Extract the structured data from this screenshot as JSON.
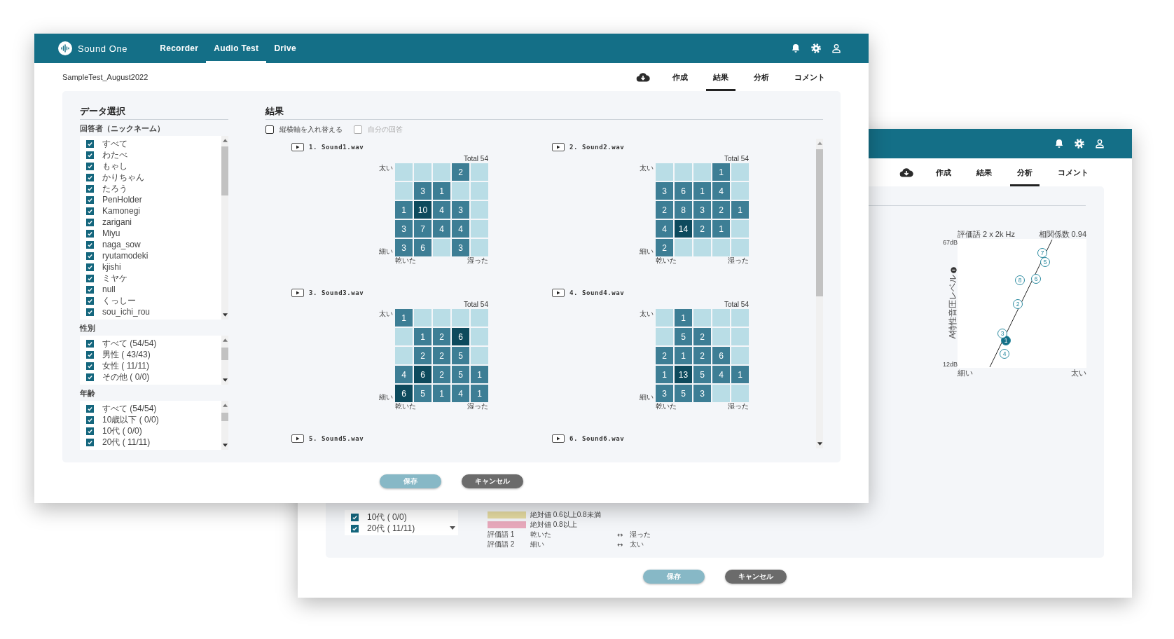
{
  "back_window": {
    "tabs": [
      {
        "label": "作成",
        "selected": false
      },
      {
        "label": "結果",
        "selected": false
      },
      {
        "label": "分析",
        "selected": true
      },
      {
        "label": "コメント",
        "selected": false
      }
    ],
    "chart": {
      "title": "評価語 2 x 2k Hz",
      "correlation": "相関係数 0.94",
      "y_top": "67dB",
      "y_bottom": "12dB",
      "y_label": "A特性音圧レベル",
      "x_left": "細い",
      "x_right": "太い",
      "points": [
        {
          "label": "1",
          "selected": true
        },
        {
          "label": "2",
          "selected": false
        },
        {
          "label": "3",
          "selected": false
        },
        {
          "label": "4",
          "selected": false
        },
        {
          "label": "5",
          "selected": false
        },
        {
          "label": "6",
          "selected": false
        },
        {
          "label": "7",
          "selected": false
        },
        {
          "label": "8",
          "selected": false
        }
      ]
    },
    "age_items": [
      {
        "label": "10代 ( 0/0)",
        "checked": true
      },
      {
        "label": "20代 ( 11/11)",
        "checked": true
      }
    ],
    "legend": [
      {
        "label": "絶対値 0.6以上0.8未満",
        "color": "#e6dca2"
      },
      {
        "label": "絶対値 0.8以上",
        "color": "#e8a9bc"
      }
    ],
    "terms": [
      {
        "name": "評価語 1",
        "left": "乾いた",
        "arrow": "↔",
        "right": "湿った"
      },
      {
        "name": "評価語 2",
        "left": "細い",
        "arrow": "↔",
        "right": "太い"
      }
    ],
    "buttons": [
      {
        "label": "保存",
        "kind": "primary",
        "disabled": true
      },
      {
        "label": "キャンセル",
        "kind": "secondary",
        "disabled": false
      }
    ]
  },
  "front_window": {
    "app": {
      "name": "Sound One",
      "nav": [
        {
          "label": "Recorder",
          "selected": false
        },
        {
          "label": "Audio Test",
          "selected": true
        },
        {
          "label": "Drive",
          "selected": false
        }
      ]
    },
    "test_name": "SampleTest_August2022",
    "tabs": [
      {
        "label": "作成",
        "selected": false
      },
      {
        "label": "結果",
        "selected": true
      },
      {
        "label": "分析",
        "selected": false
      },
      {
        "label": "コメント",
        "selected": false
      }
    ],
    "data_selection": {
      "title": "データ選択",
      "groups": [
        {
          "label": "回答者（ニックネーム）",
          "items": [
            {
              "label": "すべて",
              "checked": true
            },
            {
              "label": "わたべ",
              "checked": true
            },
            {
              "label": "もゃし",
              "checked": true
            },
            {
              "label": "かりちゃん",
              "checked": true
            },
            {
              "label": "たろう",
              "checked": true
            },
            {
              "label": "PenHolder",
              "checked": true
            },
            {
              "label": "Kamonegi",
              "checked": true
            },
            {
              "label": "zarigani",
              "checked": true
            },
            {
              "label": "Miyu",
              "checked": true
            },
            {
              "label": "naga_sow",
              "checked": true
            },
            {
              "label": "ryutamodeki",
              "checked": true
            },
            {
              "label": "kjishi",
              "checked": true
            },
            {
              "label": "ミヤケ",
              "checked": true
            },
            {
              "label": "null",
              "checked": true
            },
            {
              "label": "くっしー",
              "checked": true
            },
            {
              "label": "sou_ichi_rou",
              "checked": true
            }
          ]
        },
        {
          "label": "性別",
          "items": [
            {
              "label": "すべて (54/54)",
              "checked": true
            },
            {
              "label": "男性 ( 43/43)",
              "checked": true
            },
            {
              "label": "女性 ( 11/11)",
              "checked": true
            },
            {
              "label": "その他 ( 0/0)",
              "checked": true
            }
          ]
        },
        {
          "label": "年齢",
          "items": [
            {
              "label": "すべて (54/54)",
              "checked": true
            },
            {
              "label": "10歳以下 ( 0/0)",
              "checked": true
            },
            {
              "label": "10代 ( 0/0)",
              "checked": true
            },
            {
              "label": "20代 ( 11/11)",
              "checked": true
            }
          ]
        }
      ]
    },
    "results": {
      "title": "結果",
      "options": [
        {
          "label": "縦横軸を入れ替える",
          "checked": false,
          "disabled": false
        },
        {
          "label": "自分の回答",
          "checked": false,
          "disabled": true
        }
      ],
      "sounds": [
        {
          "name": "1. Sound1.wav",
          "total": "Total 54",
          "y_top": "太い",
          "y_bottom": "細い",
          "x_left": "乾いた",
          "x_right": "湿った",
          "grid": [
            [
              {
                "kind": "empty"
              },
              {
                "kind": "empty"
              },
              {
                "kind": "empty"
              },
              {
                "kind": "count",
                "value": "2"
              },
              {
                "kind": "empty"
              }
            ],
            [
              {
                "kind": "empty"
              },
              {
                "kind": "count",
                "value": "3"
              },
              {
                "kind": "count",
                "value": "1"
              },
              {
                "kind": "empty"
              },
              {
                "kind": "empty"
              }
            ],
            [
              {
                "kind": "count",
                "value": "1"
              },
              {
                "kind": "count",
                "value": "10"
              },
              {
                "kind": "count",
                "value": "4"
              },
              {
                "kind": "count",
                "value": "3"
              },
              {
                "kind": "empty"
              }
            ],
            [
              {
                "kind": "count",
                "value": "3"
              },
              {
                "kind": "count",
                "value": "7"
              },
              {
                "kind": "count",
                "value": "4"
              },
              {
                "kind": "count",
                "value": "4"
              },
              {
                "kind": "empty"
              }
            ],
            [
              {
                "kind": "count",
                "value": "3"
              },
              {
                "kind": "count",
                "value": "6"
              },
              {
                "kind": "empty"
              },
              {
                "kind": "count",
                "value": "3"
              },
              {
                "kind": "empty"
              }
            ]
          ]
        },
        {
          "name": "2. Sound2.wav",
          "total": "Total 54",
          "y_top": "太い",
          "y_bottom": "細い",
          "x_left": "乾いた",
          "x_right": "湿った",
          "grid": [
            [
              {
                "kind": "empty"
              },
              {
                "kind": "empty"
              },
              {
                "kind": "empty"
              },
              {
                "kind": "count",
                "value": "1"
              },
              {
                "kind": "empty"
              }
            ],
            [
              {
                "kind": "count",
                "value": "3"
              },
              {
                "kind": "count",
                "value": "6"
              },
              {
                "kind": "count",
                "value": "1"
              },
              {
                "kind": "count",
                "value": "4"
              },
              {
                "kind": "empty"
              }
            ],
            [
              {
                "kind": "count",
                "value": "2"
              },
              {
                "kind": "count",
                "value": "8"
              },
              {
                "kind": "count",
                "value": "3"
              },
              {
                "kind": "count",
                "value": "2"
              },
              {
                "kind": "count",
                "value": "1"
              }
            ],
            [
              {
                "kind": "count",
                "value": "4"
              },
              {
                "kind": "count",
                "value": "14"
              },
              {
                "kind": "count",
                "value": "2"
              },
              {
                "kind": "count",
                "value": "1"
              },
              {
                "kind": "empty"
              }
            ],
            [
              {
                "kind": "count",
                "value": "2"
              },
              {
                "kind": "empty"
              },
              {
                "kind": "empty"
              },
              {
                "kind": "empty"
              },
              {
                "kind": "empty"
              }
            ]
          ]
        },
        {
          "name": "3. Sound3.wav",
          "total": "Total 54",
          "y_top": "太い",
          "y_bottom": "細い",
          "x_left": "乾いた",
          "x_right": "湿った",
          "grid": [
            [
              {
                "kind": "count",
                "value": "1"
              },
              {
                "kind": "empty"
              },
              {
                "kind": "empty"
              },
              {
                "kind": "empty"
              },
              {
                "kind": "empty"
              }
            ],
            [
              {
                "kind": "empty"
              },
              {
                "kind": "count",
                "value": "1"
              },
              {
                "kind": "count",
                "value": "2"
              },
              {
                "kind": "count",
                "value": "6"
              },
              {
                "kind": "empty"
              }
            ],
            [
              {
                "kind": "empty"
              },
              {
                "kind": "count",
                "value": "2"
              },
              {
                "kind": "count",
                "value": "2"
              },
              {
                "kind": "count",
                "value": "5"
              },
              {
                "kind": "empty"
              }
            ],
            [
              {
                "kind": "count",
                "value": "4"
              },
              {
                "kind": "count",
                "value": "6"
              },
              {
                "kind": "count",
                "value": "2"
              },
              {
                "kind": "count",
                "value": "5"
              },
              {
                "kind": "count",
                "value": "1"
              }
            ],
            [
              {
                "kind": "count",
                "value": "6"
              },
              {
                "kind": "count",
                "value": "5"
              },
              {
                "kind": "count",
                "value": "1"
              },
              {
                "kind": "count",
                "value": "4"
              },
              {
                "kind": "count",
                "value": "1"
              }
            ]
          ]
        },
        {
          "name": "4. Sound4.wav",
          "total": "Total 54",
          "y_top": "太い",
          "y_bottom": "細い",
          "x_left": "乾いた",
          "x_right": "湿った",
          "grid": [
            [
              {
                "kind": "empty"
              },
              {
                "kind": "count",
                "value": "1"
              },
              {
                "kind": "empty"
              },
              {
                "kind": "empty"
              },
              {
                "kind": "empty"
              }
            ],
            [
              {
                "kind": "empty"
              },
              {
                "kind": "count",
                "value": "5"
              },
              {
                "kind": "count",
                "value": "2"
              },
              {
                "kind": "empty"
              },
              {
                "kind": "empty"
              }
            ],
            [
              {
                "kind": "count",
                "value": "2"
              },
              {
                "kind": "count",
                "value": "1"
              },
              {
                "kind": "count",
                "value": "2"
              },
              {
                "kind": "count",
                "value": "6"
              },
              {
                "kind": "empty"
              }
            ],
            [
              {
                "kind": "count",
                "value": "1"
              },
              {
                "kind": "count",
                "value": "13"
              },
              {
                "kind": "count",
                "value": "5"
              },
              {
                "kind": "count",
                "value": "4"
              },
              {
                "kind": "count",
                "value": "1"
              }
            ],
            [
              {
                "kind": "count",
                "value": "3"
              },
              {
                "kind": "count",
                "value": "5"
              },
              {
                "kind": "count",
                "value": "3"
              },
              {
                "kind": "empty"
              },
              {
                "kind": "empty"
              }
            ]
          ]
        },
        {
          "name": "5. Sound5.wav"
        },
        {
          "name": "6. Sound6.wav"
        }
      ]
    },
    "buttons": [
      {
        "label": "保存",
        "kind": "primary",
        "disabled": true
      },
      {
        "label": "キャンセル",
        "kind": "secondary",
        "disabled": false
      }
    ]
  }
}
